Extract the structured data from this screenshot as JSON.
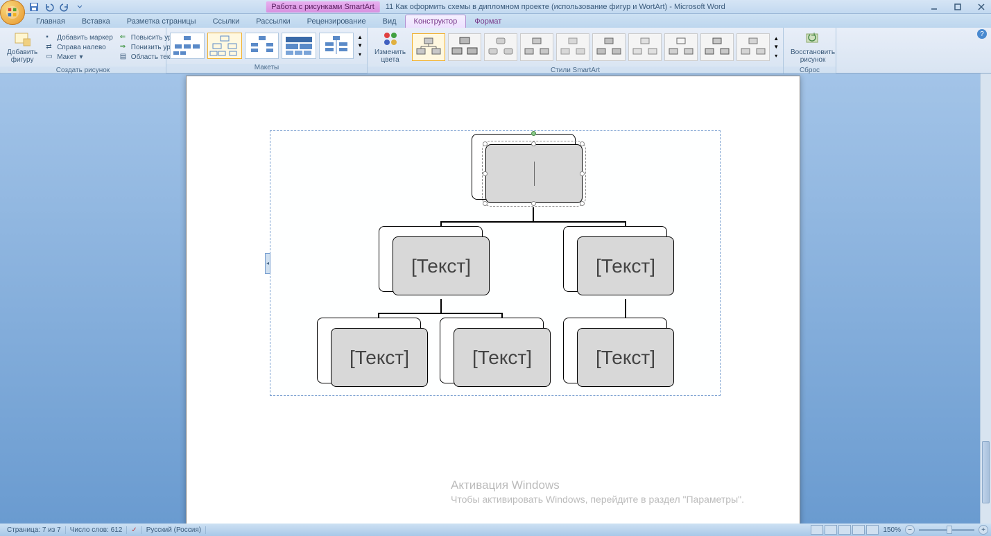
{
  "title": {
    "context_tab": "Работа с рисунками SmartArt",
    "document": "11 Как оформить схемы в дипломном проекте (использование фигур и WortArt) - Microsoft Word"
  },
  "tabs": {
    "home": "Главная",
    "insert": "Вставка",
    "pagelayout": "Разметка страницы",
    "references": "Ссылки",
    "mailings": "Рассылки",
    "review": "Рецензирование",
    "view": "Вид",
    "design": "Конструктор",
    "format": "Формат"
  },
  "ribbon": {
    "add_shape": "Добавить\nфигуру",
    "add_bullet": "Добавить маркер",
    "rtl": "Справа налево",
    "layout_menu": "Макет",
    "promote": "Повысить уровень",
    "demote": "Понизить уровень",
    "text_pane": "Область текста",
    "group_create": "Создать рисунок",
    "group_layouts": "Макеты",
    "change_colors": "Изменить\nцвета",
    "group_styles": "Стили SmartArt",
    "reset": "Восстановить\nрисунок",
    "group_reset": "Сброс"
  },
  "smartart": {
    "placeholder": "[Текст]",
    "node_top": "",
    "node_a": "[Текст]",
    "node_b": "[Текст]",
    "node_a1": "[Текст]",
    "node_a2": "[Текст]",
    "node_b1": "[Текст]"
  },
  "status": {
    "page": "Страница: 7 из 7",
    "words": "Число слов: 612",
    "language": "Русский (Россия)",
    "zoom": "150%"
  },
  "watermark": {
    "title": "Активация Windows",
    "sub": "Чтобы активировать Windows, перейдите в раздел \"Параметры\"."
  }
}
